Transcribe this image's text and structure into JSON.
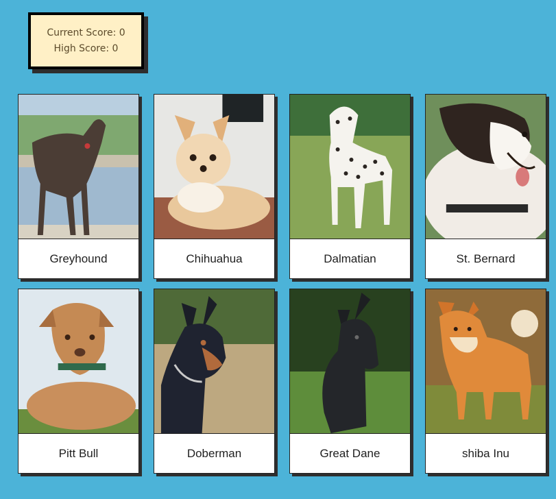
{
  "score": {
    "current_label": "Current Score: 0",
    "high_label": "High Score: 0"
  },
  "cards": [
    {
      "name": "Greyhound"
    },
    {
      "name": "Chihuahua"
    },
    {
      "name": "Dalmatian"
    },
    {
      "name": "St. Bernard"
    },
    {
      "name": "Pitt Bull"
    },
    {
      "name": "Doberman"
    },
    {
      "name": "Great Dane"
    },
    {
      "name": "shiba Inu"
    }
  ],
  "colors": {
    "background": "#4cb3d8",
    "scoreboard": "#fff0c6"
  }
}
